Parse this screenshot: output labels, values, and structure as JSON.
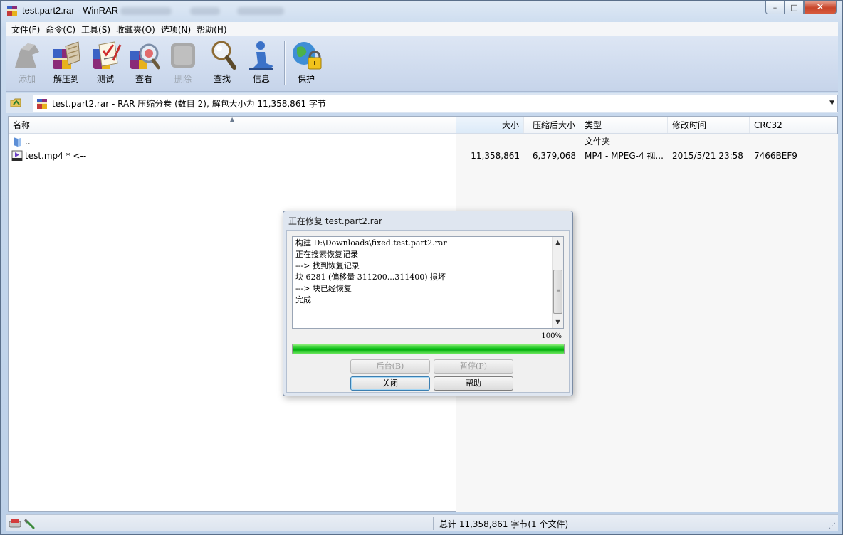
{
  "window": {
    "title": "test.part2.rar - WinRAR",
    "caption": {
      "minimize": "–",
      "maximize": "□",
      "close": "✕"
    }
  },
  "menu": [
    "文件(F)",
    "命令(C)",
    "工具(S)",
    "收藏夹(O)",
    "选项(N)",
    "帮助(H)"
  ],
  "toolbar": [
    {
      "label": "添加",
      "icon": "add-icon",
      "enabled": false
    },
    {
      "label": "解压到",
      "icon": "extract-to-icon",
      "enabled": true
    },
    {
      "label": "测试",
      "icon": "test-icon",
      "enabled": true
    },
    {
      "label": "查看",
      "icon": "view-icon",
      "enabled": true
    },
    {
      "label": "删除",
      "icon": "delete-icon",
      "enabled": false
    },
    {
      "label": "查找",
      "icon": "find-icon",
      "enabled": true
    },
    {
      "label": "信息",
      "icon": "info-icon",
      "enabled": true
    },
    {
      "label": "保护",
      "icon": "protect-icon",
      "enabled": true
    }
  ],
  "address": {
    "text": "test.part2.rar - RAR 压缩分卷 (数目 2), 解包大小为 11,358,861 字节"
  },
  "columns": [
    "名称",
    "大小",
    "压缩后大小",
    "类型",
    "修改时间",
    "CRC32"
  ],
  "rows": [
    {
      "name": "..",
      "size": "",
      "packed": "",
      "type": "文件夹",
      "modified": "",
      "crc": "",
      "icon": "folder-up-icon"
    },
    {
      "name": "test.mp4 * <--",
      "size": "11,358,861",
      "packed": "6,379,068",
      "type": "MP4 - MPEG-4 视...",
      "modified": "2015/5/21 23:58",
      "crc": "7466BEF9",
      "icon": "mp4-file-icon"
    }
  ],
  "status": {
    "text": "总计 11,358,861 字节(1 个文件)"
  },
  "dialog": {
    "title": "正在修复 test.part2.rar",
    "log": [
      "构建 D:\\Downloads\\fixed.test.part2.rar",
      "正在搜索恢复记录",
      "---> 找到恢复记录",
      "块 6281 (偏移量 311200...311400) 损坏",
      "---> 块已经恢复",
      "完成"
    ],
    "progress_percent_label": "100%",
    "progress_value": 1.0,
    "buttons": {
      "background": "后台(B)",
      "pause": "暂停(P)",
      "close": "关闭",
      "help": "帮助"
    }
  },
  "colors": {
    "progress": "#11c11a",
    "titlebar": "#c9daee",
    "toolbar": "#c6d4ea"
  }
}
